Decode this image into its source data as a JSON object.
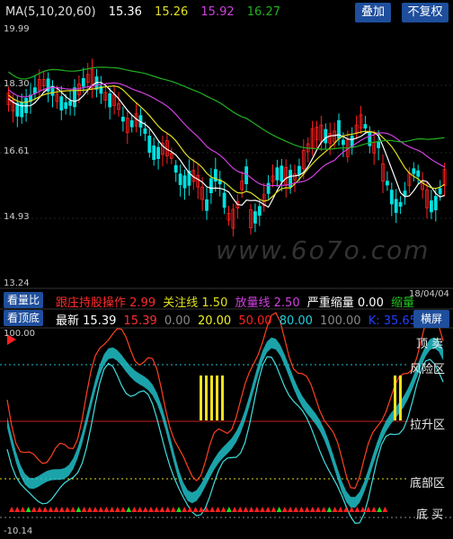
{
  "top_bar": {
    "ma_label": "MA(5,10,20,60)",
    "ma5": "15.36",
    "ma10": "15.26",
    "ma20": "15.92",
    "ma60": "16.27",
    "overlay_button": "叠加",
    "no_adjust_button": "不复权"
  },
  "price_axis": [
    "19.99",
    "18.30",
    "16.61",
    "14.93",
    "13.24"
  ],
  "watermark": "www.6o7o.com",
  "indicator_bar1": {
    "tab_label": "看量比",
    "items": [
      {
        "label": "跟庄持股操作",
        "value": "2.99",
        "color": "#ff2a2a"
      },
      {
        "label": "关注线",
        "value": "1.50",
        "color": "#e0e020"
      },
      {
        "label": "放量线",
        "value": "2.50",
        "color": "#d040e0"
      },
      {
        "label": "严重缩量",
        "value": "0.00",
        "color": "#ffffff"
      },
      {
        "label": "缩量",
        "value": "",
        "color": "#20c020"
      }
    ],
    "date": "18/04/04"
  },
  "indicator_bar2": {
    "tab_label": "看顶底",
    "latest_label": "最新",
    "latest_value": "15.39",
    "values": [
      {
        "v": "15.39",
        "color": "#ff3030"
      },
      {
        "v": "0.00",
        "color": "#888888"
      },
      {
        "v": "20.00",
        "color": "#f0f020"
      },
      {
        "v": "50.00",
        "color": "#ff2020"
      },
      {
        "v": "80.00",
        "color": "#20d0e0"
      },
      {
        "v": "100.00",
        "color": "#888888"
      },
      {
        "v": "K: 35.65",
        "color": "#2040ff"
      }
    ],
    "landscape_button": "横屏"
  },
  "lower_axis": {
    "top": "100.00",
    "bottom": "-10.14"
  },
  "lower_labels": {
    "top_sell": "顶  卖",
    "risk": "风险区",
    "lift": "拉升区",
    "bottom": "底部区",
    "bottom_buy": "底  买"
  },
  "colors": {
    "up": "#ff2020",
    "down": "#00e0e0",
    "ma5": "#ffffff",
    "ma10": "#e0e020",
    "ma20": "#d040e0",
    "ma60": "#20b020",
    "button": "#1e4e9c"
  }
}
